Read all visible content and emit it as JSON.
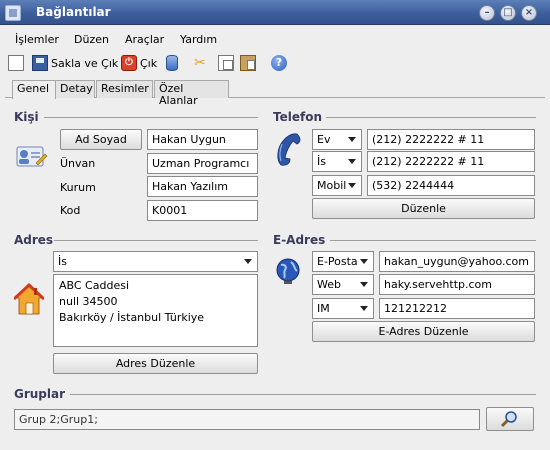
{
  "window": {
    "title": "Bağlantılar",
    "min_icon": "minimize-icon",
    "max_icon": "maximize-icon",
    "close_icon": "close-icon"
  },
  "menu": [
    "İşlemler",
    "Düzen",
    "Araçlar",
    "Yardım"
  ],
  "toolbar": {
    "save_label": "Sakla ve Çık",
    "exit_label": "Çık"
  },
  "tabs": [
    "Genel",
    "Detay",
    "Resimler",
    "Özel Alanlar"
  ],
  "kisi": {
    "title": "Kişi",
    "name_button": "Ad Soyad",
    "name": "Hakan Uygun",
    "unvan_label": "Ünvan",
    "unvan": "Uzman Programcı",
    "kurum_label": "Kurum",
    "kurum": "Hakan Yazılım",
    "kod_label": "Kod",
    "kod": "K0001"
  },
  "telefon": {
    "title": "Telefon",
    "rows": [
      {
        "type": "Ev",
        "number": "(212) 2222222 # 11"
      },
      {
        "type": "İs",
        "number": "(212) 2222222 # 11"
      },
      {
        "type": "Mobil",
        "number": "(532) 2244444"
      }
    ],
    "edit_button": "Düzenle"
  },
  "adres": {
    "title": "Adres",
    "type": "İs",
    "text": "ABC Caddesi\nnull 34500\nBakırköy / İstanbul Türkiye",
    "edit_button": "Adres Düzenle"
  },
  "eadres": {
    "title": "E-Adres",
    "rows": [
      {
        "type": "E-Posta",
        "value": "hakan_uygun@yahoo.com"
      },
      {
        "type": "Web",
        "value": "haky.servehttp.com"
      },
      {
        "type": "IM",
        "value": "121212212"
      }
    ],
    "edit_button": "E-Adres Düzenle"
  },
  "gruplar": {
    "title": "Gruplar",
    "value": "Grup 2;Grup1;"
  },
  "colors": {
    "titlebar": "#3d5f9c",
    "phone_icon": "#2f55a8"
  }
}
